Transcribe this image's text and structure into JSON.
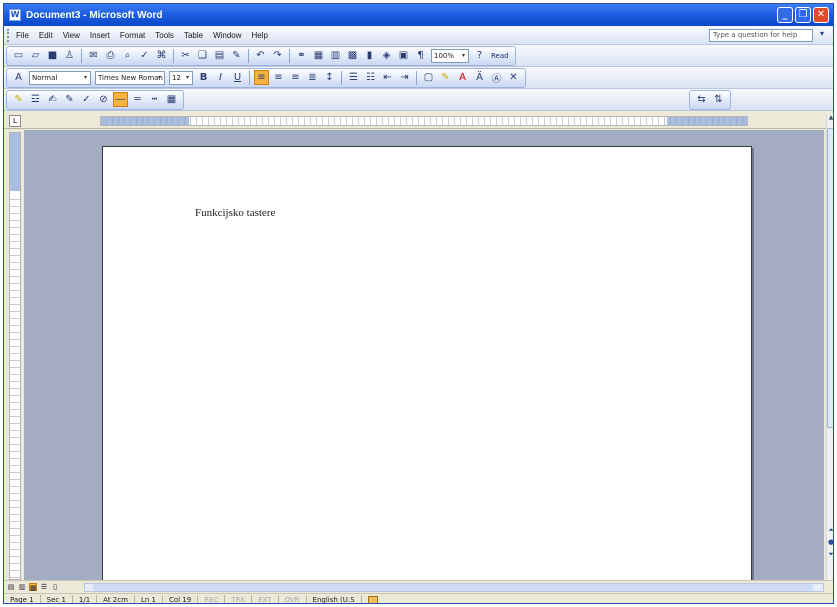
{
  "window": {
    "title": "Document3 - Microsoft Word"
  },
  "menubar": {
    "items": [
      "File",
      "Edit",
      "View",
      "Insert",
      "Format",
      "Tools",
      "Table",
      "Window",
      "Help"
    ],
    "help_box": "Type a question for help"
  },
  "toolbar": {
    "zoom": "100%",
    "read_label": "Read",
    "style": "Normal",
    "font": "Times New Roman",
    "font_size": "12"
  },
  "document": {
    "body_text": "Funkcijsko tastere"
  },
  "statusbar": {
    "page": "Page 1",
    "sec": "Sec 1",
    "page_of": "1/1",
    "at": "At 2cm",
    "ln": "Ln 1",
    "col": "Col 19",
    "rec": "REC",
    "trk": "TRK",
    "ext": "EXT",
    "ovr": "OVR",
    "language": "English (U.S"
  },
  "colors": {
    "title_blue": "#0a46c8",
    "workspace": "#a3acc0",
    "active_orange": "#f6b340"
  }
}
